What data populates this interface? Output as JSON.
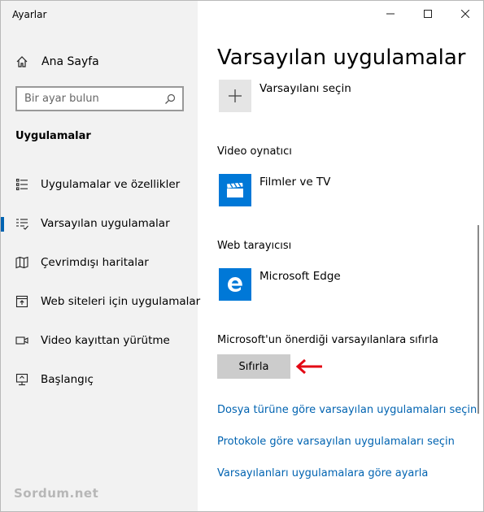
{
  "window": {
    "title": "Ayarlar"
  },
  "sidebar": {
    "home_label": "Ana Sayfa",
    "search": {
      "placeholder": "Bir ayar bulun"
    },
    "section_title": "Uygulamalar",
    "items": [
      {
        "label": "Uygulamalar ve özellikler",
        "icon": "apps-list-icon",
        "active": false
      },
      {
        "label": "Varsayılan uygulamalar",
        "icon": "default-apps-icon",
        "active": true
      },
      {
        "label": "Çevrimdışı haritalar",
        "icon": "map-icon",
        "active": false
      },
      {
        "label": "Web siteleri için uygulamalar",
        "icon": "open-in-app-icon",
        "active": false
      },
      {
        "label": "Video kayıttan yürütme",
        "icon": "video-icon",
        "active": false
      },
      {
        "label": "Başlangıç",
        "icon": "startup-icon",
        "active": false
      }
    ]
  },
  "watermark": "Sordum.net",
  "main": {
    "title": "Varsayılan uygulamalar",
    "choose_default": {
      "label": "Varsayılanı seçin",
      "icon": "plus-icon"
    },
    "video_player": {
      "heading": "Video oynatıcı",
      "app": "Filmler ve TV",
      "icon": "movies-tv-icon"
    },
    "web_browser": {
      "heading": "Web tarayıcısı",
      "app": "Microsoft Edge",
      "icon": "edge-icon"
    },
    "reset": {
      "description": "Microsoft'un önerdiği varsayılanlara sıfırla",
      "button_label": "Sıfırla"
    },
    "links": [
      "Dosya türüne göre varsayılan uygulamaları seçin",
      "Protokole göre varsayılan uygulamaları seçin",
      "Varsayılanları uygulamalara göre ayarla"
    ]
  },
  "colors": {
    "accent": "#0078d7",
    "link": "#0063b1",
    "sidebar_bg": "#f2f2f2",
    "annotation_arrow": "#e30613"
  }
}
